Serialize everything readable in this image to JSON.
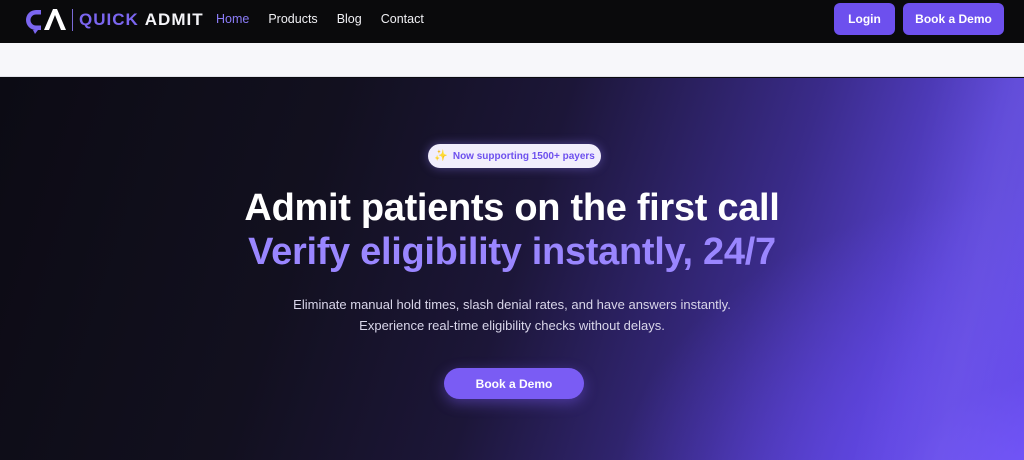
{
  "header": {
    "brand": {
      "quick": "QUICK",
      "admit": "ADMIT"
    },
    "nav": [
      {
        "label": "Home",
        "active": true
      },
      {
        "label": "Products",
        "active": false
      },
      {
        "label": "Blog",
        "active": false
      },
      {
        "label": "Contact",
        "active": false
      }
    ],
    "login_label": "Login",
    "demo_label": "Book a Demo"
  },
  "hero": {
    "badge_icon": "sparkles-icon",
    "badge_text": "Now supporting 1500+ payers",
    "headline": "Admit patients on the first call",
    "subheadline": "Verify eligibility instantly, 24/7",
    "description_line1": "Eliminate manual hold times, slash denial rates, and have answers instantly.",
    "description_line2": "Experience real-time eligibility checks without delays.",
    "cta_label": "Book a Demo"
  },
  "colors": {
    "accent": "#6d50ee",
    "accent_light": "#9a86ff",
    "topbar_bg": "#0a0a0c",
    "strip_bg": "#f7f7fa"
  }
}
